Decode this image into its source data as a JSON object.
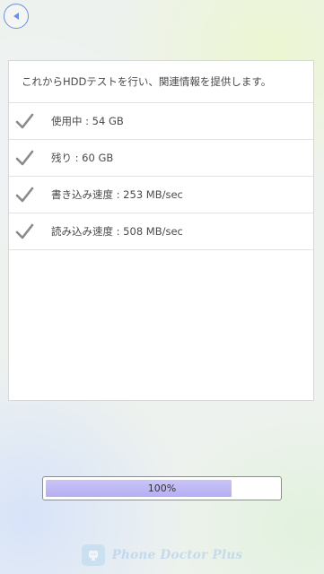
{
  "nav": {
    "back_icon": "back-arrow-icon",
    "accent_color": "#6d8fe0"
  },
  "panel": {
    "intro": "これからHDDテストを行い、関連情報を提供します。",
    "items": [
      {
        "label": "使用中 : 54 GB",
        "icon": "checkmark-icon"
      },
      {
        "label": "残り : 60 GB",
        "icon": "checkmark-icon"
      },
      {
        "label": "書き込み速度 : 253 MB/sec",
        "icon": "checkmark-icon"
      },
      {
        "label": "読み込み速度 : 508 MB/sec",
        "icon": "checkmark-icon"
      }
    ]
  },
  "progress": {
    "value": 1.0,
    "label": "100%",
    "fill_color": "#b5aef2"
  },
  "brand": {
    "name": "Phone Doctor Plus",
    "logo_icon": "app-logo-icon"
  }
}
